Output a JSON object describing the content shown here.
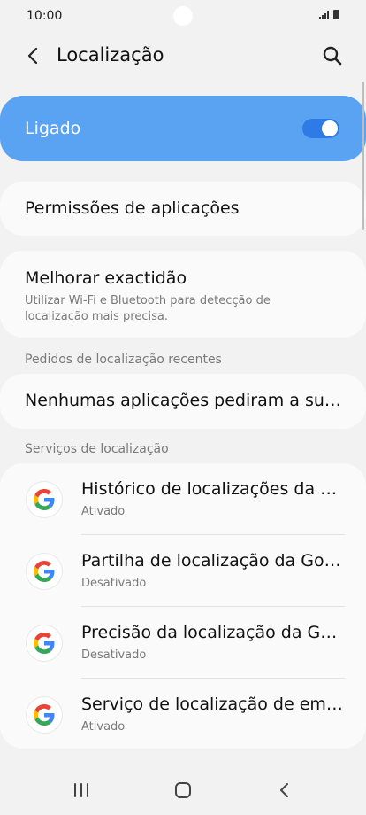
{
  "status_bar": {
    "time": "10:00"
  },
  "header": {
    "title": "Localização"
  },
  "master": {
    "label": "Ligado",
    "state": "on"
  },
  "permissions": {
    "title": "Permissões de aplicações"
  },
  "accuracy": {
    "title": "Melhorar exactidão",
    "subtitle": "Utilizar Wi-Fi e Bluetooth para detecção de localização mais precisa."
  },
  "recent": {
    "header": "Pedidos de localização recentes",
    "item": "Nenhumas aplicações pediram a sua localização recentemente"
  },
  "services": {
    "header": "Serviços de localização",
    "items": [
      {
        "title": "Histórico de localizações da Google",
        "status": "Ativado"
      },
      {
        "title": "Partilha de localização da Google",
        "status": "Desativado"
      },
      {
        "title": "Precisão da localização da Google",
        "status": "Desativado"
      },
      {
        "title": "Serviço de localização de emergência",
        "status": "Ativado"
      }
    ]
  },
  "colors": {
    "accent": "#5aa3f2",
    "switch_track": "#2f7be6",
    "background": "#f2f2f2"
  }
}
